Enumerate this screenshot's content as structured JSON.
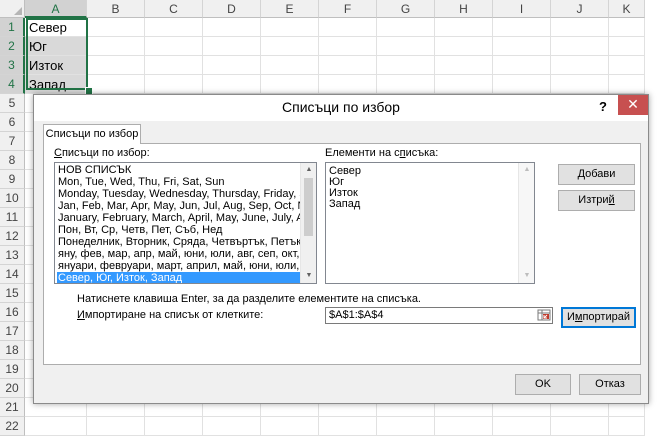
{
  "sheet": {
    "columns": [
      "A",
      "B",
      "C",
      "D",
      "E",
      "F",
      "G",
      "H",
      "I",
      "J",
      "K"
    ],
    "rows": [
      "1",
      "2",
      "3",
      "4",
      "5",
      "6",
      "7",
      "8",
      "9",
      "10",
      "11",
      "12",
      "13",
      "14",
      "15",
      "16",
      "17",
      "18",
      "19",
      "20",
      "21",
      "22"
    ],
    "cells": [
      "Север",
      "Юг",
      "Изток",
      "Запад"
    ]
  },
  "dialog": {
    "title": "Списъци по избор",
    "help_label": "?",
    "close_label": "✕",
    "tab_label": "Списъци по избор",
    "custom_lists_label": "Списъци по избор:",
    "custom_lists": [
      "НОВ СПИСЪК",
      "Mon, Tue, Wed, Thu, Fri, Sat, Sun",
      "Monday, Tuesday, Wednesday, Thursday, Friday, Saturday, S",
      "Jan, Feb, Mar, Apr, May, Jun, Jul, Aug, Sep, Oct, Nov, Dec",
      "January, February, March, April, May, June, July, August, Sep",
      "Пон, Вт, Ср, Четв, Пет, Съб, Нед",
      "Понеделник, Вторник, Сряда, Четвъртък, Петък, Събота,",
      "яну, фев, мар, апр, май, юни, юли, авг, сеп, окт, ное, дек",
      "януари, февруари, март, април, май, юни, юли, август, се",
      "Север, Юг, Изток, Запад"
    ],
    "selected_list_index": 9,
    "entries_label": "Елементи на списъка:",
    "entries": [
      "Север",
      "Юг",
      "Изток",
      "Запад"
    ],
    "add_label": "Добави",
    "delete_label": "Изтрий",
    "hint": "Натиснете клавиша Enter, за да разделите елементите на списъка.",
    "import_label": "Импортиране на списък от клетките:",
    "import_value": "$A$1:$A$4",
    "import_button": "Импортирай",
    "ok_label": "OK",
    "cancel_label": "Отказ"
  },
  "colors": {
    "excel_green": "#217346",
    "selection_blue": "#3399ff",
    "close_red": "#c75050",
    "focus_blue": "#0078d7"
  }
}
